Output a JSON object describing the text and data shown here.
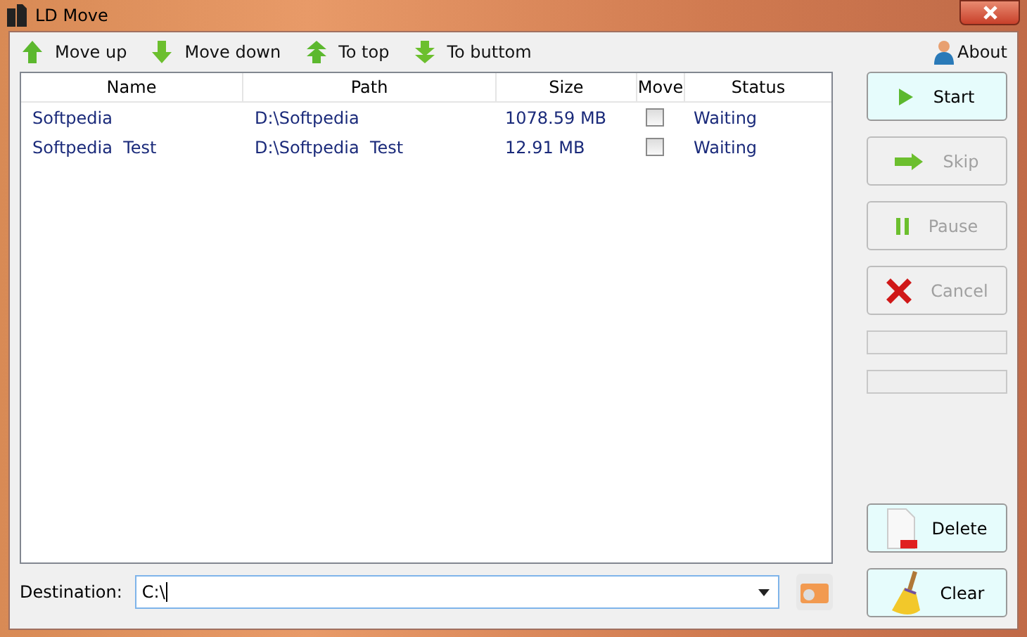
{
  "window": {
    "title": "LD Move"
  },
  "toolbar": [
    {
      "label": "Move up",
      "kind": "up"
    },
    {
      "label": "Move down",
      "kind": "down"
    },
    {
      "label": "To top",
      "kind": "top"
    },
    {
      "label": "To buttom",
      "kind": "bottom"
    }
  ],
  "about": {
    "label": "About"
  },
  "table": {
    "columns": [
      "Name",
      "Path",
      "Size",
      "Move",
      "Status"
    ],
    "rows": [
      {
        "name": "Softpedia",
        "path": "D:\\Softpedia",
        "size": "1078.59 MB",
        "checked": false,
        "status": "Waiting"
      },
      {
        "name": "Softpedia  Test",
        "path": "D:\\Softpedia  Test",
        "size": "12.91 MB",
        "checked": false,
        "status": "Waiting"
      }
    ]
  },
  "actions": [
    {
      "label": "Start",
      "kind": "start",
      "disabled": false
    },
    {
      "label": "Skip",
      "kind": "skip",
      "disabled": true
    },
    {
      "label": "Pause",
      "kind": "pause",
      "disabled": true
    },
    {
      "label": "Cancel",
      "kind": "cancel",
      "disabled": true
    }
  ],
  "progress": [
    {
      "level": 0
    },
    {
      "level": 0
    }
  ],
  "bottom_actions": [
    {
      "label": "Delete",
      "kind": "delete",
      "disabled": false
    },
    {
      "label": "Clear",
      "kind": "clear",
      "disabled": false
    }
  ],
  "destination": {
    "label": "Destination:",
    "value": "C:\\"
  }
}
